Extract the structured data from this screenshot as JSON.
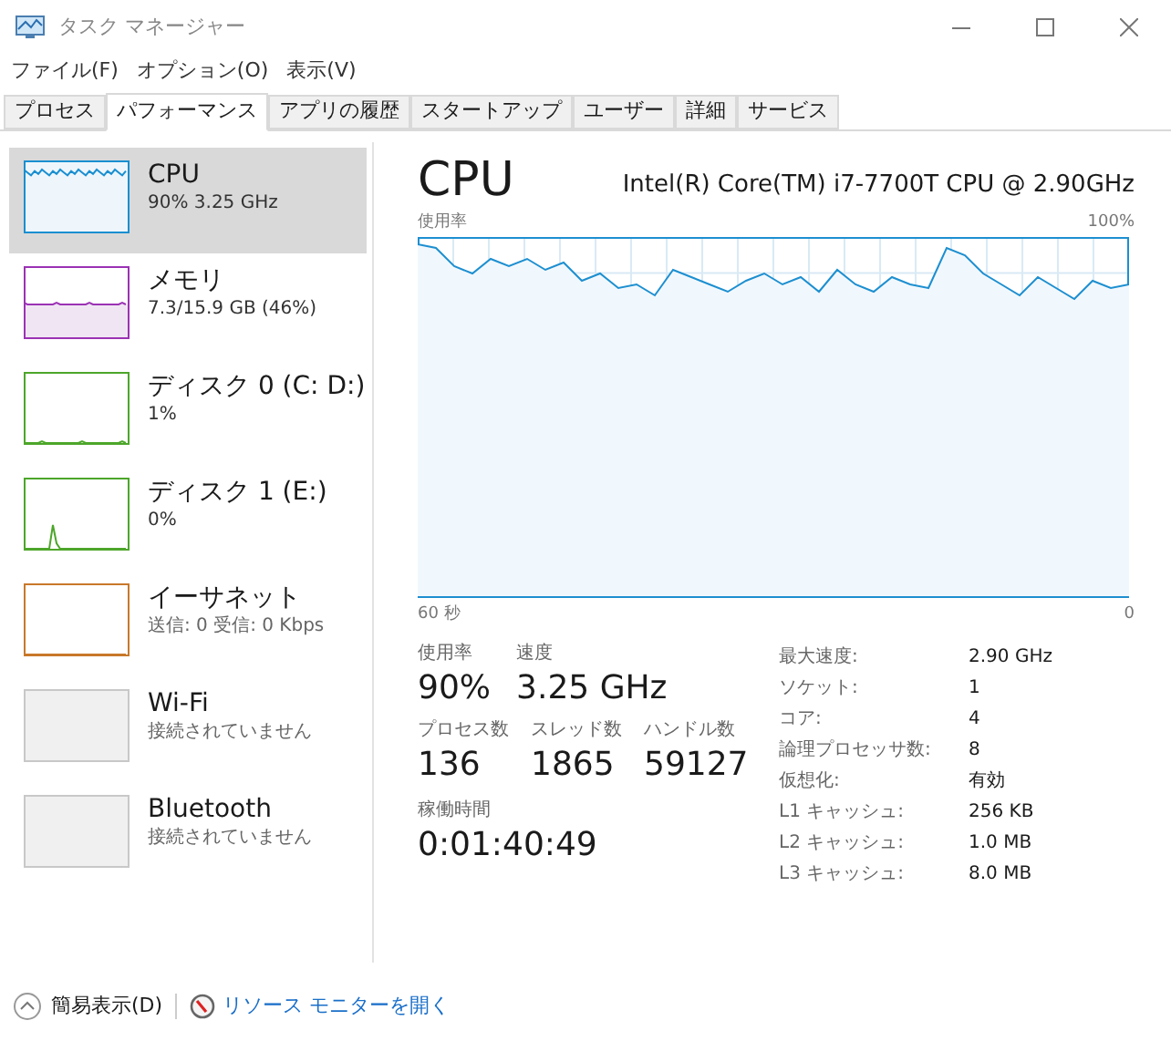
{
  "window": {
    "title": "タスク マネージャー"
  },
  "menu": [
    "ファイル(F)",
    "オプション(O)",
    "表示(V)"
  ],
  "tabs": [
    {
      "label": "プロセス",
      "selected": false
    },
    {
      "label": "パフォーマンス",
      "selected": true
    },
    {
      "label": "アプリの履歴",
      "selected": false
    },
    {
      "label": "スタートアップ",
      "selected": false
    },
    {
      "label": "ユーザー",
      "selected": false
    },
    {
      "label": "詳細",
      "selected": false
    },
    {
      "label": "サービス",
      "selected": false
    }
  ],
  "sidebar": {
    "items": [
      {
        "kind": "cpu",
        "name": "CPU",
        "detail": "90%  3.25 GHz",
        "selected": true,
        "color": "#1a8fd0"
      },
      {
        "kind": "memory",
        "name": "メモリ",
        "detail": "7.3/15.9 GB (46%)",
        "selected": false,
        "color": "#9b32b4"
      },
      {
        "kind": "disk",
        "name": "ディスク 0 (C: D:)",
        "detail": "1%",
        "selected": false,
        "color": "#4da62a"
      },
      {
        "kind": "disk_spike",
        "name": "ディスク 1 (E:)",
        "detail": "0%",
        "selected": false,
        "color": "#4da62a"
      },
      {
        "kind": "network",
        "name": "イーサネット",
        "detail": "送信: 0 受信: 0 Kbps",
        "selected": false,
        "color": "#c8782a"
      },
      {
        "kind": "off",
        "name": "Wi-Fi",
        "detail": "接続されていません",
        "selected": false
      },
      {
        "kind": "off",
        "name": "Bluetooth",
        "detail": "接続されていません",
        "selected": false
      }
    ]
  },
  "panel": {
    "title": "CPU",
    "model": "Intel(R) Core(TM) i7-7700T CPU @ 2.90GHz",
    "graph": {
      "label": "使用率",
      "max_label": "100%",
      "time_label": "60 秒",
      "min_label": "0"
    },
    "stats": [
      {
        "label": "使用率",
        "value": "90%"
      },
      {
        "label": "速度",
        "value": "3.25 GHz"
      }
    ],
    "counts": [
      {
        "label": "プロセス数",
        "value": "136"
      },
      {
        "label": "スレッド数",
        "value": "1865"
      },
      {
        "label": "ハンドル数",
        "value": "59127"
      }
    ],
    "uptime": {
      "label": "稼働時間",
      "value": "0:01:40:49"
    },
    "specs": [
      {
        "label": "最大速度:",
        "value": "2.90 GHz"
      },
      {
        "label": "ソケット:",
        "value": "1"
      },
      {
        "label": "コア:",
        "value": "4"
      },
      {
        "label": "論理プロセッサ数:",
        "value": "8"
      },
      {
        "label": "仮想化:",
        "value": "有効"
      },
      {
        "label": "L1 キャッシュ:",
        "value": "256 KB"
      },
      {
        "label": "L2 キャッシュ:",
        "value": "1.0 MB"
      },
      {
        "label": "L3 キャッシュ:",
        "value": "8.0 MB"
      }
    ]
  },
  "footer": {
    "fewer_details": "簡易表示(D)",
    "resource_monitor": "リソース モニターを開く"
  }
}
